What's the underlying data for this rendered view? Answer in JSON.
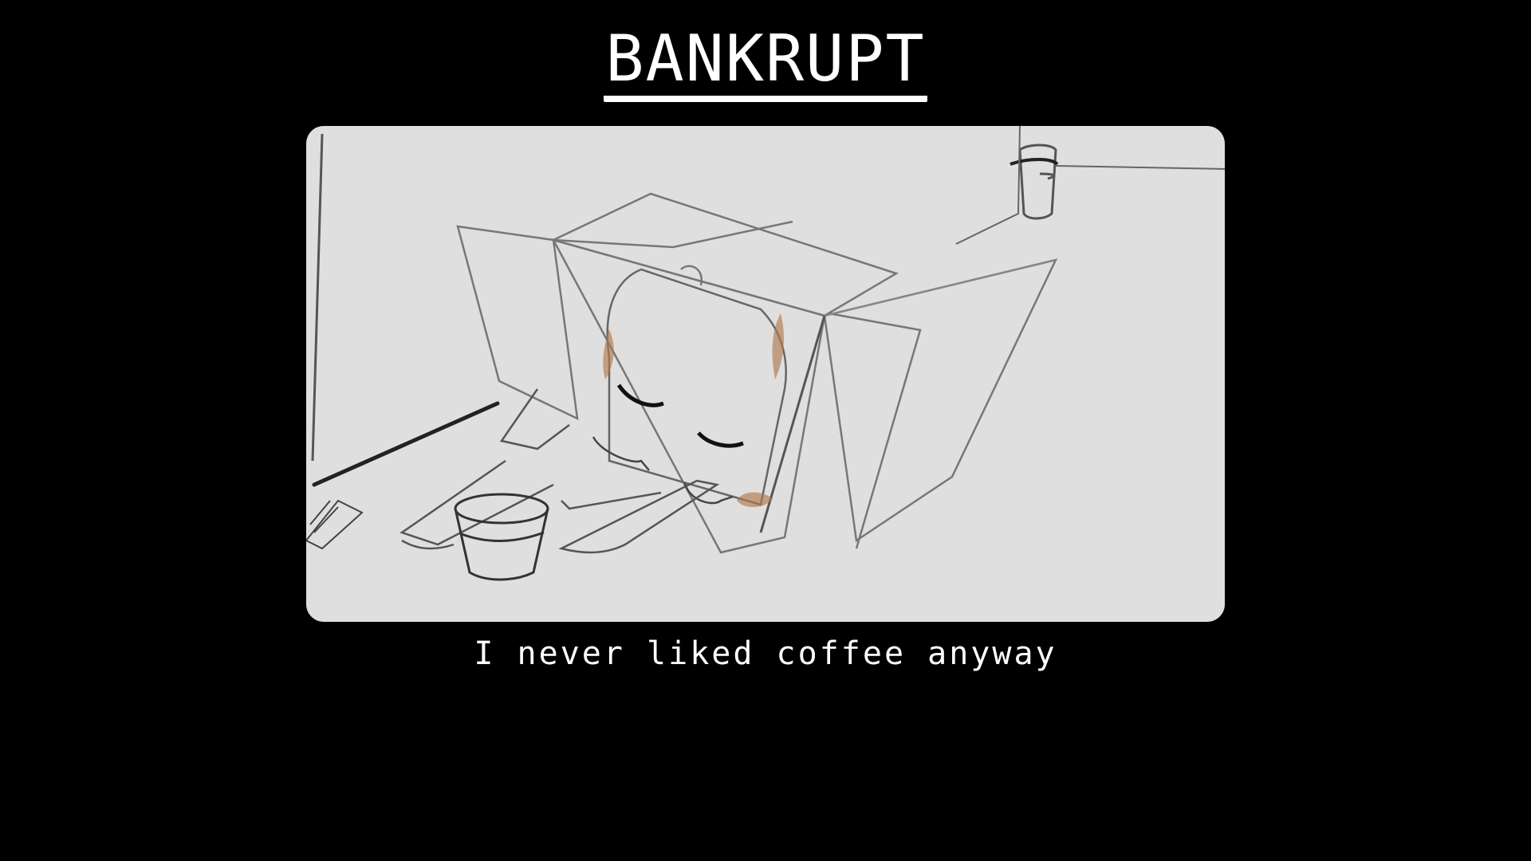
{
  "header": {
    "title": "BANKRUPT"
  },
  "scene": {
    "caption": "I never liked coffee anyway"
  },
  "colors": {
    "background": "#000000",
    "panel": "#dfdfdf",
    "text": "#ffffff",
    "sketch_line": "#444444",
    "coffee_stain": "#b07a4e"
  }
}
